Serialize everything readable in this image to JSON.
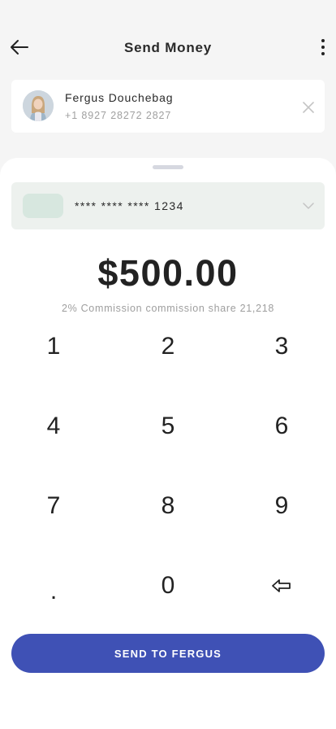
{
  "header": {
    "title": "Send Money",
    "back_icon": "arrow-left-icon",
    "more_icon": "more-vertical-icon"
  },
  "recipient": {
    "name": "Fergus Douchebag",
    "phone": "+1 8927 28272 2827",
    "close_icon": "close-icon"
  },
  "card": {
    "number": "**** **** **** 1234",
    "chevron_icon": "chevron-down-icon"
  },
  "amount": {
    "value": "$500.00",
    "commission": "2% Commission commission share 21,218"
  },
  "keypad": {
    "keys": [
      "1",
      "2",
      "3",
      "4",
      "5",
      "6",
      "7",
      "8",
      "9",
      ".",
      "0",
      "⇦"
    ],
    "backspace_icon": "backspace-icon"
  },
  "send_button": {
    "label": "SEND TO FERGUS"
  },
  "colors": {
    "accent": "#3f51b5",
    "background": "#f5f5f5",
    "card_select_bg": "#edf1ee"
  }
}
